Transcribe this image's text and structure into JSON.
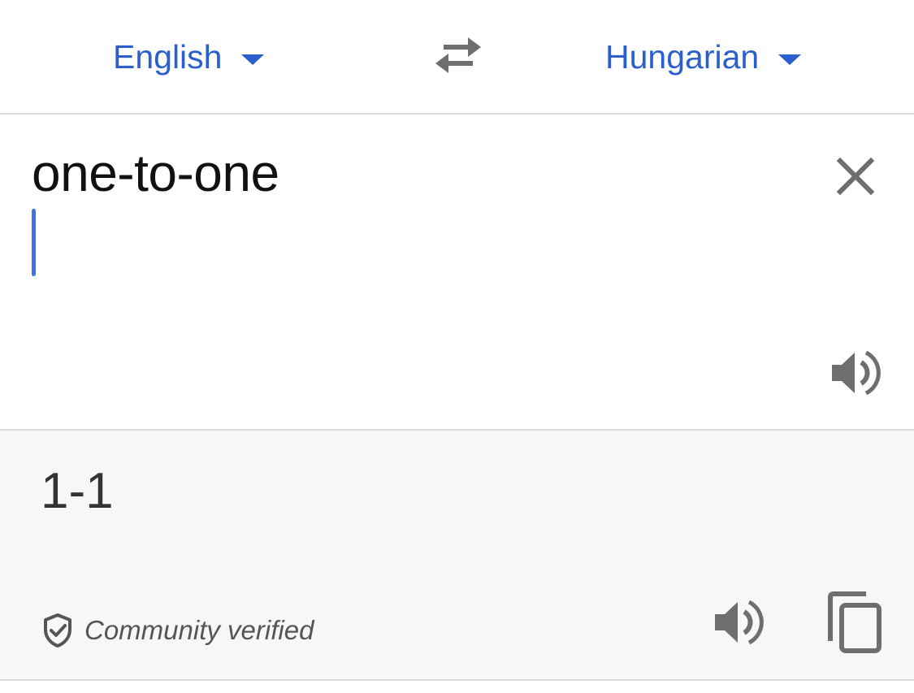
{
  "language_bar": {
    "source_language": "English",
    "target_language": "Hungarian",
    "swap_icon": "swap-arrows-icon",
    "dropdown_icon": "caret-down-icon"
  },
  "input": {
    "text": "one-to-one",
    "clear_icon": "close-icon",
    "speak_icon": "speaker-icon"
  },
  "output": {
    "translation": "1-1",
    "verified_label": "Community verified",
    "verified_icon": "shield-check-icon",
    "speak_icon": "speaker-icon",
    "copy_icon": "copy-icon"
  },
  "colors": {
    "accent": "#2b5fce",
    "caret": "#3d73e6",
    "icon": "#6e6e6e",
    "output_background": "#f7f7f7",
    "divider": "#dadce0"
  }
}
